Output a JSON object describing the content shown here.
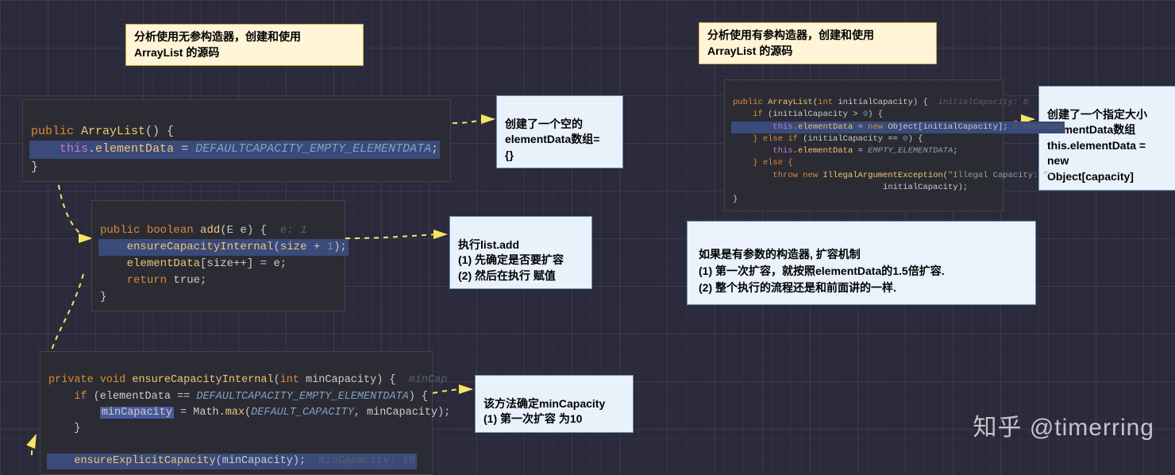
{
  "notes": {
    "yellow_left": "分析使用无参构造器，创建和使用\nArrayList 的源码",
    "yellow_right": "分析使用有参构造器，创建和使用\nArrayList 的源码",
    "blue_ctor": "创建了一个空的\nelementData数组=\n{}",
    "blue_add": "执行list.add\n(1) 先确定是否要扩容\n(2) 然后在执行 赋值",
    "blue_ensure": "该方法确定minCapacity\n(1) 第一次扩容 为10",
    "blue_right_ctor": "创建了一个指定大小\nelementData数组\nthis.elementData = new\nObject[capacity]",
    "big_right": "如果是有参数的构造器, 扩容机制\n(1) 第一次扩容，就按照elementData的1.5倍扩容.\n(2) 整个执行的流程还是和前面讲的一样."
  },
  "code": {
    "ctor_noarg": {
      "l0_kw": "public",
      "l0_name": "ArrayList",
      "l0_tail": "() {",
      "l1_this": "this",
      "l1_dot": ".",
      "l1_field": "elementData",
      "l1_eq": " = ",
      "l1_const": "DEFAULTCAPACITY_EMPTY_ELEMENTDATA",
      "l1_end": ";",
      "l2": "}"
    },
    "add": {
      "l0_kw": "public",
      "l0_bool": "boolean",
      "l0_name": "add",
      "l0_sig": "(E e) {",
      "l0_cmt": "  e: 1",
      "l1_name": "ensureCapacityInternal",
      "l1_open": "(",
      "l1_size": "size",
      "l1_plus": " + ",
      "l1_one": "1",
      "l1_close": ");",
      "l2_a": "elementData",
      "l2_idx": "[size++]",
      "l2_eq": " = e;",
      "l3_kw": "return",
      "l3_val": " true;",
      "l4": "}"
    },
    "ensure": {
      "l0_kw": "private",
      "l0_void": "void",
      "l0_name": "ensureCapacityInternal",
      "l0_open": "(",
      "l0_int": "int",
      "l0_p": " minCapacity",
      "l0_close": ") {",
      "l0_cmt": "  minCap",
      "l1_if": "if",
      "l1_open": " (elementData == ",
      "l1_const": "DEFAULTCAPACITY_EMPTY_ELEMENTDATA",
      "l1_close": ") {",
      "l2_var": "minCapacity",
      "l2_eq": " = Math.",
      "l2_max": "max",
      "l2_open": "(",
      "l2_c": "DEFAULT_CAPACITY",
      "l2_sep": ", minCapacity);",
      "l3": "}",
      "l4_blank": "",
      "l5_call": "ensureExplicitCapacity",
      "l5_args": "(minCapacity);",
      "l5_cmt": "  minCapacity: 10"
    },
    "ctor_arg": {
      "l0_kw": "public",
      "l0_name": "ArrayList",
      "l0_open": "(",
      "l0_int": "int",
      "l0_p": " initialCapacity",
      "l0_close": ") {",
      "l0_cmt": "  initialCapacity: 8",
      "l1_if": "if",
      "l1_cond": " (initialCapacity > ",
      "l1_zero": "0",
      "l1_close": ") {",
      "l2_this": "this",
      "l2_dot": ".",
      "l2_field": "elementData",
      "l2_eq": " = ",
      "l2_new": "new",
      "l2_obj": " Object[initialCapacity];",
      "l2_cmt": " elementDat",
      "l3_else": "} else if",
      "l3_cond": " (initialCapacity == ",
      "l3_zero": "0",
      "l3_close": ") {",
      "l4_this": "this",
      "l4_dot": ".",
      "l4_field": "elementData",
      "l4_eq": " = ",
      "l4_const": "EMPTY_ELEMENTDATA",
      "l4_end": ";",
      "l5_else": "} else {",
      "l6_throw": "throw new",
      "l6_ex": " IllegalArgumentException(",
      "l6_str": "\"Illegal Capacity: \"",
      "l6_plus": "+",
      "l7_arg": "                              initialCapacity);",
      "l8": "}"
    }
  },
  "watermark": "知乎 @timerring"
}
